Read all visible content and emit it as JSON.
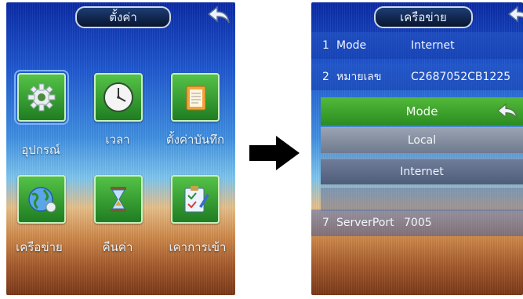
{
  "left_screen": {
    "title": "ตั้งค่า",
    "icons": [
      {
        "label": "อุปกรณ์",
        "icon": "gear-icon"
      },
      {
        "label": "เวลา",
        "icon": "clock-icon"
      },
      {
        "label": "ตั้งค่าบันทึก",
        "icon": "notebook-icon"
      },
      {
        "label": "เครือข่าย",
        "icon": "network-globe-icon"
      },
      {
        "label": "คืนค่า",
        "icon": "hourglass-icon"
      },
      {
        "label": "เคาการเข้า",
        "icon": "clipboard-icon"
      }
    ]
  },
  "right_screen": {
    "title": "เครือข่าย",
    "rows": [
      {
        "num": "1",
        "name": "Mode",
        "value": "Internet"
      },
      {
        "num": "2",
        "name": "หมายเลข",
        "value": "C2687052CB1225"
      },
      {
        "num": "7",
        "name": "ServerPort",
        "value": "7005"
      }
    ],
    "popup": {
      "title": "Mode",
      "options": [
        "Local",
        "Internet"
      ]
    }
  }
}
